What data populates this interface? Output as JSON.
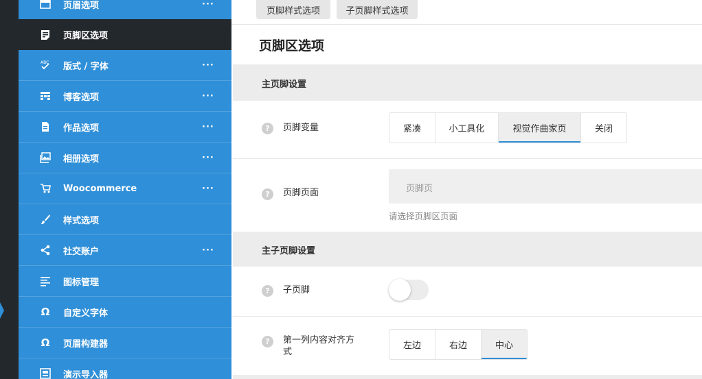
{
  "sidebar": {
    "items": [
      {
        "label": "页眉选项",
        "icon": "header-icon",
        "more": "···",
        "active": false
      },
      {
        "label": "页脚区选项",
        "icon": "footer-icon",
        "more": "",
        "active": true
      },
      {
        "label": "版式 / 字体",
        "icon": "spellcheck-icon",
        "more": "···",
        "active": false
      },
      {
        "label": "博客选项",
        "icon": "blog-grid-icon",
        "more": "···",
        "active": false
      },
      {
        "label": "作品选项",
        "icon": "document-icon",
        "more": "···",
        "active": false
      },
      {
        "label": "相册选项",
        "icon": "gallery-icon",
        "more": "···",
        "active": false
      },
      {
        "label": "Woocommerce",
        "icon": "cart-icon",
        "more": "···",
        "active": false
      },
      {
        "label": "样式选项",
        "icon": "brush-icon",
        "more": "",
        "active": false
      },
      {
        "label": "社交账户",
        "icon": "share-icon",
        "more": "···",
        "active": false
      },
      {
        "label": "图标管理",
        "icon": "list-icon",
        "more": "",
        "active": false
      },
      {
        "label": "自定义字体",
        "icon": "omega-icon",
        "more": "",
        "active": false
      },
      {
        "label": "页眉构建器",
        "icon": "omega-icon",
        "more": "",
        "active": false
      },
      {
        "label": "演示导入器",
        "icon": "import-icon",
        "more": "",
        "active": false
      }
    ]
  },
  "main": {
    "subtabs": [
      "页脚样式选项",
      "子页脚样式选项"
    ],
    "title": "页脚区选项",
    "sections": [
      {
        "title": "主页脚设置"
      },
      {
        "title": "主子页脚设置"
      }
    ],
    "fields": {
      "footer_variant": {
        "label": "页脚变量",
        "options": [
          "紧凑",
          "小工具化",
          "视觉作曲家页",
          "关闭"
        ],
        "selected": "视觉作曲家页"
      },
      "footer_page": {
        "label": "页脚页面",
        "placeholder": "页脚页",
        "description": "请选择页脚区页面"
      },
      "sub_footer": {
        "label": "子页脚",
        "value": false
      },
      "col1_align": {
        "label": "第一列内容对齐方式",
        "label_line1": "第一列内容对齐方",
        "label_line2": "式",
        "options": [
          "左边",
          "右边",
          "中心"
        ],
        "selected": "中心"
      }
    },
    "help_glyph": "?"
  },
  "colors": {
    "sidebar": "#2f8fd8",
    "active": "#23282d",
    "accent": "#2f8fd8"
  }
}
